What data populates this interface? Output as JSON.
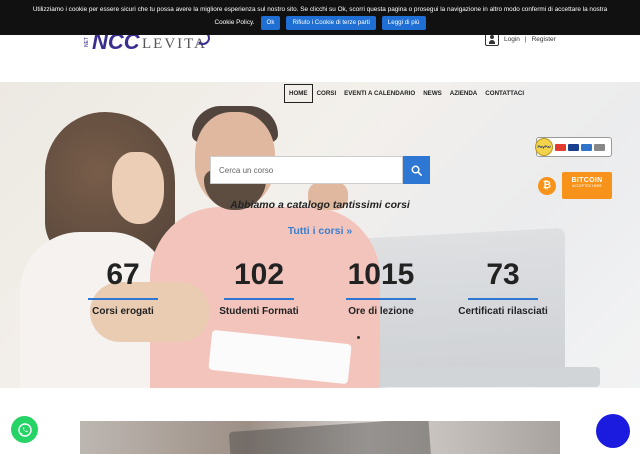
{
  "cookie_bar": {
    "text_line1": "Utilizziamo i cookie per essere sicuri che tu possa avere la migliore esperienza sul nostro sito. Se clicchi su Ok, scorri questa pagina o prosegui la navigazione in altro modo confermi di accettare la nostra",
    "text_line2": "Cookie Policy.",
    "ok_label": "Ok",
    "reject_label": "Rifiuto i Cookie di terze parti",
    "read_more_label": "Leggi di più"
  },
  "header": {
    "logo_text": "LEVITA",
    "logo_mark": "NCC",
    "logo_vertical": "NET",
    "login_label": "Login",
    "separator": "|",
    "register_label": "Register",
    "nav": [
      "HOME",
      "CORSI",
      "EVENTI A CALENDARIO",
      "NEWS",
      "AZIENDA",
      "CONTATTACI"
    ]
  },
  "hero": {
    "search_placeholder": "Cerca un corso",
    "tagline": "Abbiamo a catalogo tantissimi corsi",
    "all_courses_label": "Tutti i corsi  »",
    "stats": [
      {
        "value": "67",
        "label": "Corsi erogati"
      },
      {
        "value": "102",
        "label": "Studenti Formati"
      },
      {
        "value": "1015",
        "label": "Ore di lezione"
      },
      {
        "value": "73",
        "label": "Certificati rilasciati"
      }
    ],
    "paypal_seal": "PayPal",
    "bitcoin_label": "BITCOIN",
    "bitcoin_sub": "ACCEPTED HERE",
    "bitcoin_symbol": "₿"
  },
  "colors": {
    "accent": "#2e78d4",
    "cookie_bg": "#111111",
    "bitcoin": "#f7931a",
    "whatsapp": "#25d366",
    "chat": "#1b1be0"
  },
  "icons": [
    "user-icon",
    "search-icon",
    "whatsapp-icon",
    "chat-icon",
    "bitcoin-icon"
  ]
}
